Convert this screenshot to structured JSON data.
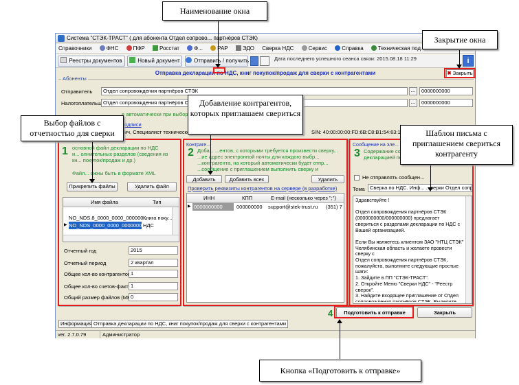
{
  "window": {
    "title": "Система \"СТЭК-ТРАСТ\" ( для абонента Отдел сопрово... партнёров СТЭК)",
    "menu": [
      "Справочники",
      "ФНС",
      "ПФР",
      "Росстат",
      "Ф...",
      "РАР",
      "ЭДО",
      "Сверка НДС",
      "Сервис",
      "Справка",
      "Техническая под..."
    ],
    "toolbar": {
      "registry_btn": "Реестры документов",
      "new_doc_btn": "Новый документ",
      "send_receive_btn": "Отправить / получить",
      "last_session": "Дата последнего успешного сеанса связи: 2015.08.18 11:29"
    },
    "subtitle": "Отправка декларации по НДС, книг покупок/продаж для сверки с контрагентами",
    "close_button": "Закрыть"
  },
  "subscribers": {
    "group_title": "Абоненты",
    "sender_label": "Отправитель",
    "sender_value": "Отдел сопровождения партнёров СТЭК",
    "sender_code": "0000000000",
    "taxpayer_label": "Налогоплательщик",
    "taxpayer_value": "Отдел сопровождения партнёров СТЭК",
    "taxpayer_code": "0000000000",
    "auto_note": "е автоматически при выборе со... ...\"",
    "signature_link": "подписи",
    "signer_text": "вич, Специалист технической по...",
    "serial_text": "S/N: 40:00:00:00:FD:6B:C8:B1:54:63:1"
  },
  "panel1": {
    "number": "1",
    "desc_line1": "основной файл декларации по НДС",
    "desc_line2": "и... олнительных разделов (сведения из",
    "desc_line3": "кн... покупок/продаж и др.)",
    "format_note": "Файл... ожны быть в формате XML",
    "attach_btn": "Прикрепить файлы",
    "delete_btn": "Удалить файл",
    "col_name": "Имя файла",
    "col_type": "Тип",
    "rows": [
      {
        "name": "NO_NDS.8_0000_0000_000000...",
        "type": "Книга поку..."
      },
      {
        "name": "NO_NDS_0000_0000_00000000...",
        "type": "НДС"
      }
    ],
    "props": [
      {
        "label": "Отчетный год",
        "value": "2015"
      },
      {
        "label": "Отчетный период",
        "value": "2 квартал"
      },
      {
        "label": "Общее кол-во контрагентов",
        "value": "1"
      },
      {
        "label": "Общее кол-во счетов-фактур",
        "value": "1"
      },
      {
        "label": "Общий размер файлов (МБ)",
        "value": "0"
      }
    ]
  },
  "panel2": {
    "title": "Контраге...",
    "number": "2",
    "desc": "Доба... ...ентов, с которыми требуется произвести сверку... ...ие адрес электронной почты для каждого выбр... ...контрагента, на который автоматически будет отпр... ...сообщение с приглашением выполнить сверку и",
    "add_btn": "Добавить",
    "add_all_btn": "Добавить всех",
    "delete_btn": "Удалить",
    "check_link": "Проверить реквизиты контрагентов на сервере (в разработке)",
    "col_inn": "ИНН",
    "col_kpp": "КПП",
    "col_email": "E-mail (несколько через \";\")",
    "rows": [
      {
        "inn": "0000000000",
        "kpp": "000000000",
        "email": "support@stek-trust.ru",
        "extra": "(351) 7"
      }
    ]
  },
  "panel3": {
    "title": "Сообщение на эле...",
    "number": "3",
    "desc": "Содержание соо... автоматически ... декларацией по... сообщение мож...",
    "no_send_label": "Не отправлять сообщен...",
    "subject_label": "Тема",
    "subject_value": "Сверка по НДС. Инф... ...верки Отдел сопр...",
    "body": "Здравствуйте !\n\nОтдел сопровождения партнёров СТЭК (0000000000/000000000) предлагает свериться с разделами декларации по НДС с Вашей организацией.\n\nЕсли Вы являетесь клиентом ЗАО \"НТЦ СТЭК\" Челябинская область и желаете провести сверку с\nОтдел сопровождения партнёров СТЭК, пожалуйста, выполните следующие простые шаги:\n1. Зайдите в ПП \"СТЭК-ТРАСТ\".\n2. Откройте Меню \"Сверки НДС\" - \"Реестр сверок\".\n3. Найдите входящее приглашение от Отдел сопровождения партнёров СТЭК. Выделите его"
  },
  "bottom": {
    "step_number": "4",
    "prepare_btn": "Подготовить к отправке",
    "close_btn": "Закрыть",
    "tab_info": "Информация",
    "tab_main": "Отправка декларации по НДС, книг покупок/продаж для сверки с контрагентами",
    "version": "ver. 2.7.0.79",
    "user": "Администратор"
  },
  "callouts": {
    "window_name": "Наименование окна",
    "window_close": "Закрытие окна",
    "file_select": "Выбор файлов с отчетностью для сверки",
    "add_contractors": "Добавление контрагентов, которых приглашаем свериться",
    "letter_template": "Шаблон письма с приглашением свериться контрагенту",
    "prepare_button": "Кнопка «Подготовить к отправке»"
  },
  "colors": {
    "annotation_red": "#e31b1b",
    "link_blue": "#1a2fb6",
    "step_green": "#1a8a2e",
    "selection_blue": "#1f63c8"
  }
}
